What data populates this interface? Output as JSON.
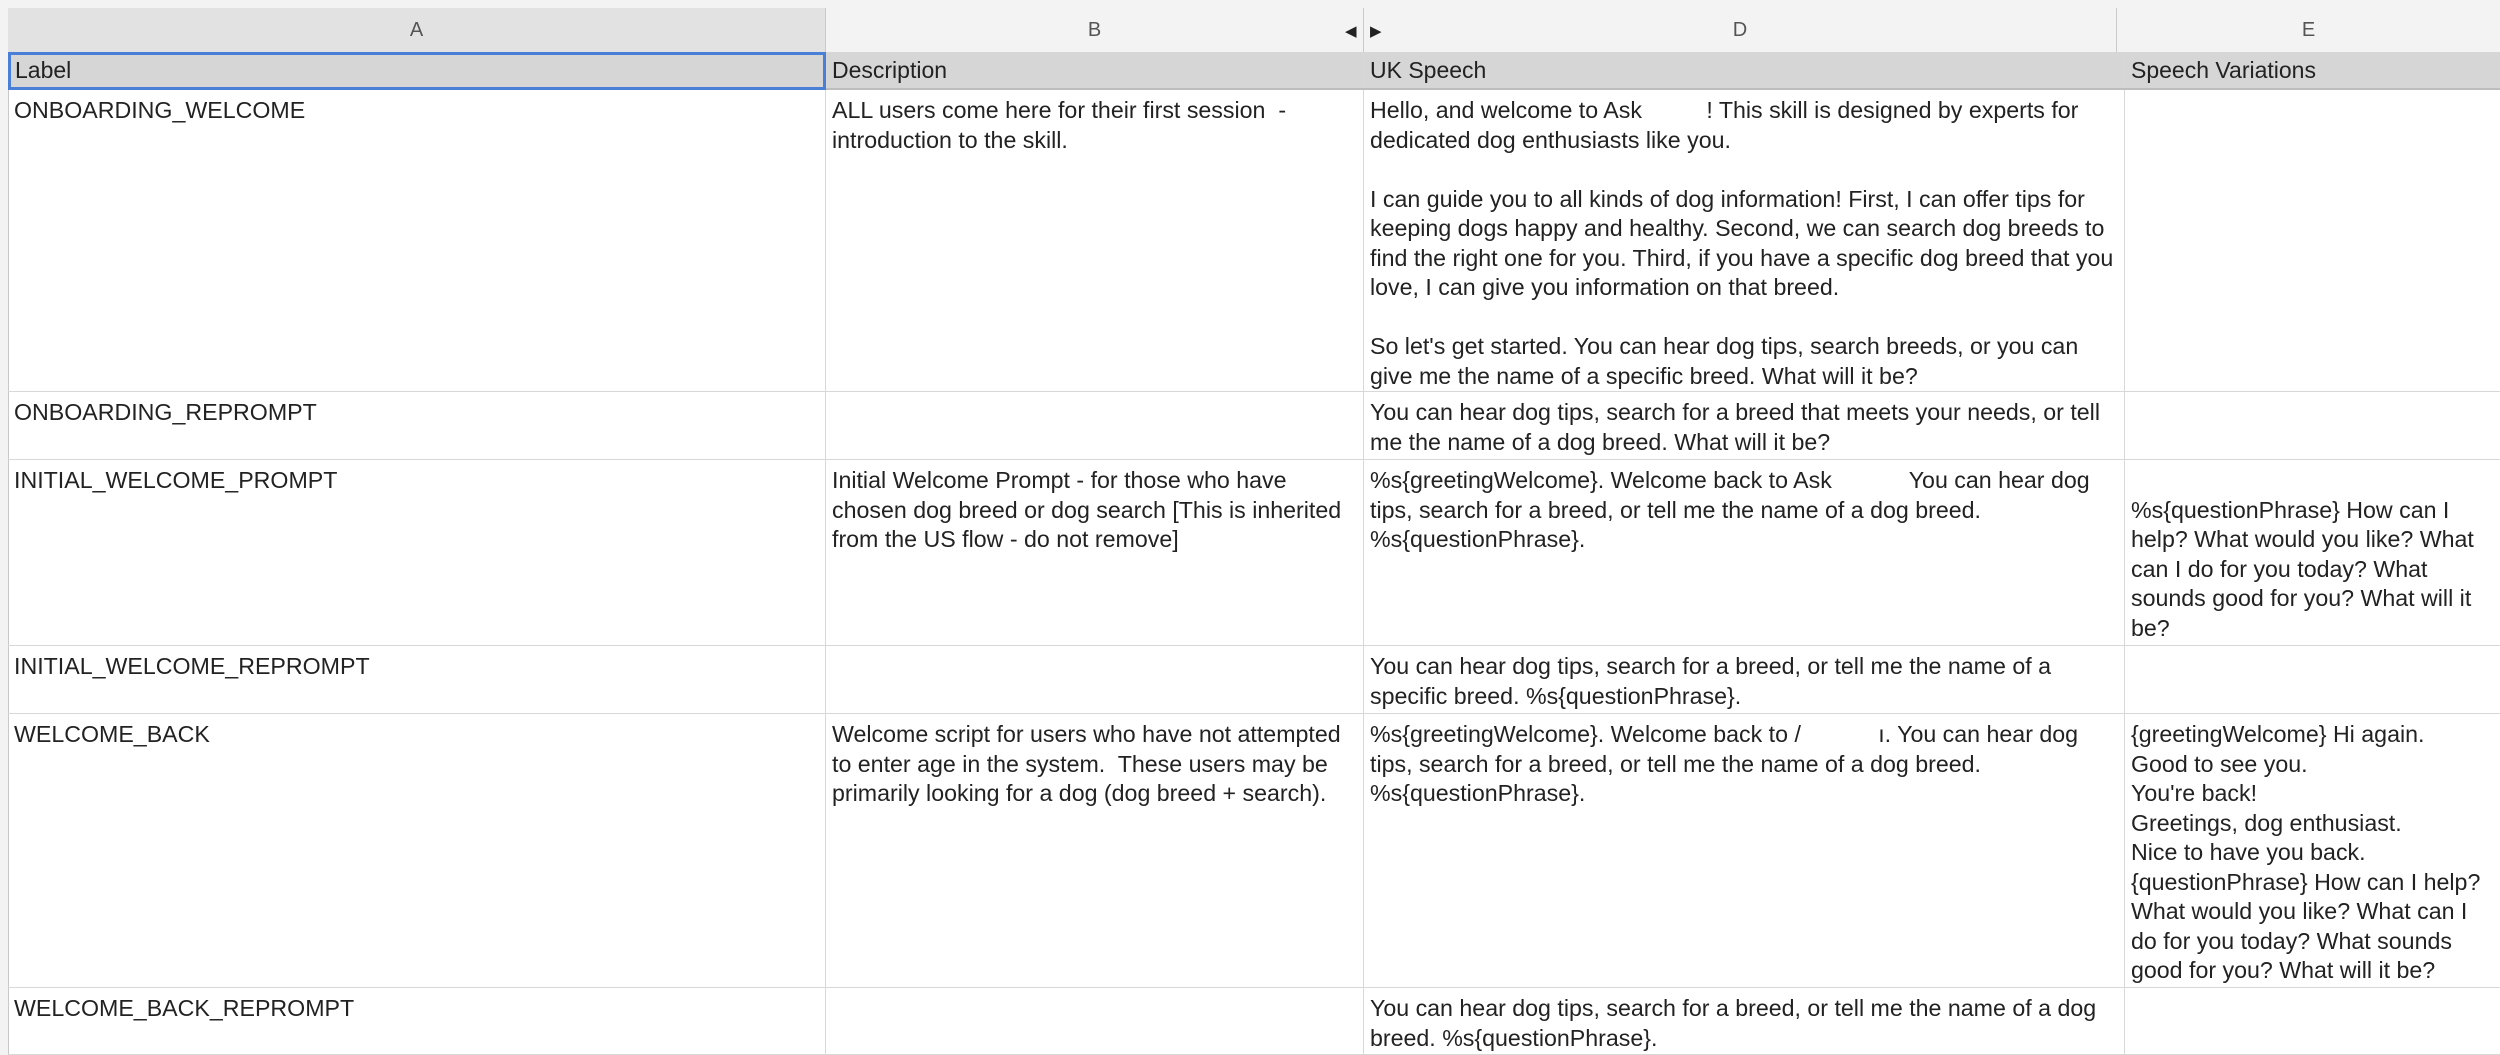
{
  "columns": {
    "a": "A",
    "b": "B",
    "d": "D",
    "e": "E"
  },
  "header": {
    "label": "Label",
    "description": "Description",
    "uk_speech": "UK Speech",
    "variations": "Speech Variations"
  },
  "rows": [
    {
      "label": "ONBOARDING_WELCOME",
      "description": "ALL users come here for their first session  - introduction to the skill.",
      "speech": "Hello, and welcome to Ask          ! This skill is designed by experts for dedicated dog enthusiasts like you.\n\nI can guide you to all kinds of dog information! First, I can offer tips for keeping dogs happy and healthy. Second, we can search dog breeds to find the right one for you. Third, if you have a specific dog breed that you love, I can give you information on that breed.\n\nSo let's get started. You can hear dog tips, search breeds, or you can give me the name of a specific breed. What will it be?",
      "variations": ""
    },
    {
      "label": "ONBOARDING_REPROMPT",
      "description": "",
      "speech": "You can hear dog tips, search for a breed that meets your needs, or tell me the name of a dog breed. What will it be?",
      "variations": ""
    },
    {
      "label": "INITIAL_WELCOME_PROMPT",
      "description": "Initial Welcome Prompt - for those who have chosen dog breed or dog search [This is inherited from the US flow - do not remove]",
      "speech": "%s{greetingWelcome}. Welcome back to Ask            You can hear dog tips, search for a breed, or tell me the name of a dog breed. %s{questionPhrase}.",
      "variations": "\n%s{questionPhrase} How can I help? What would you like? What can I do for you today? What sounds good for you? What will it be?"
    },
    {
      "label": "INITIAL_WELCOME_REPROMPT",
      "description": "",
      "speech": "You can hear dog tips, search for a breed, or tell me the name of a specific breed. %s{questionPhrase}.",
      "variations": ""
    },
    {
      "label": "WELCOME_BACK",
      "description": "Welcome script for users who have not attempted to enter age in the system.  These users may be primarily looking for a dog (dog breed + search).",
      "speech": "%s{greetingWelcome}. Welcome back to /            ı. You can hear dog tips, search for a breed, or tell me the name of a dog breed. %s{questionPhrase}.",
      "variations": "{greetingWelcome} Hi again.\nGood to see you.\nYou're back!\nGreetings, dog enthusiast.\nNice to have you back.\n{questionPhrase} How can I help? What would you like? What can I do for you today? What sounds good for you? What will it be?"
    },
    {
      "label": "WELCOME_BACK_REPROMPT",
      "description": "",
      "speech": "You can hear dog tips, search for a breed, or tell me the name of a dog breed. %s{questionPhrase}.",
      "variations": ""
    }
  ]
}
